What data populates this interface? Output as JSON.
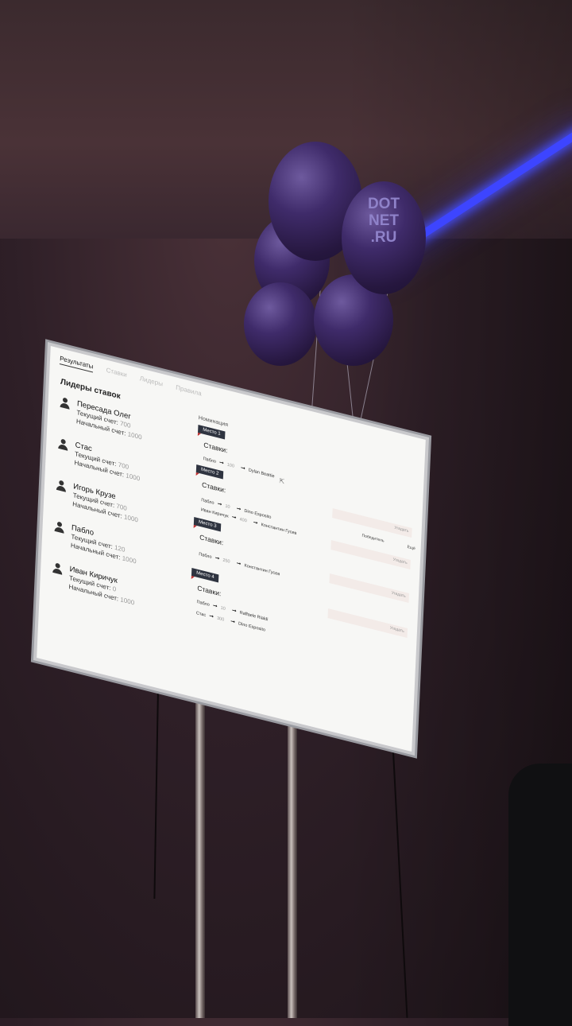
{
  "balloon_text": "DOT\nNET\n.RU",
  "tabs": [
    "Результаты",
    "Ставки",
    "Лидеры",
    "Правила"
  ],
  "leaders_title": "Лидеры ставок",
  "current_label": "Текущий счет:",
  "start_label": "Начальный счет:",
  "leaders": [
    {
      "name": "Пересада Олег",
      "current": "700",
      "start": "1000"
    },
    {
      "name": "Стас",
      "current": "700",
      "start": "1000"
    },
    {
      "name": "Игорь Крузе",
      "current": "700",
      "start": "1000"
    },
    {
      "name": "Пабло",
      "current": "120",
      "start": "1000"
    },
    {
      "name": "Иван Киричук",
      "current": "0",
      "start": "1000"
    }
  ],
  "nominations_title": "Номинация",
  "stakes_label": "Ставки:",
  "header_winner": "Победитель",
  "header_more": "Ещё",
  "pick_label": "Угадать",
  "places": [
    {
      "label": "Место 1",
      "bets": [
        {
          "who": "Пабло",
          "amount": "100",
          "target": "Dylan Beattie"
        }
      ]
    },
    {
      "label": "Место 2",
      "bets": [
        {
          "who": "Пабло",
          "amount": "10",
          "target": "Dino Esposito"
        },
        {
          "who": "Иван Киричук",
          "amount": "400",
          "target": "Константин Гусев"
        }
      ]
    },
    {
      "label": "Место 3",
      "bets": [
        {
          "who": "Пабло",
          "amount": "250",
          "target": "Константин Гусев"
        }
      ]
    },
    {
      "label": "Место 4",
      "bets": [
        {
          "who": "Пабло",
          "amount": "10",
          "target": "Raffaele Rialdi"
        },
        {
          "who": "Стас",
          "amount": "300",
          "target": "Dino Esposito"
        }
      ]
    }
  ]
}
